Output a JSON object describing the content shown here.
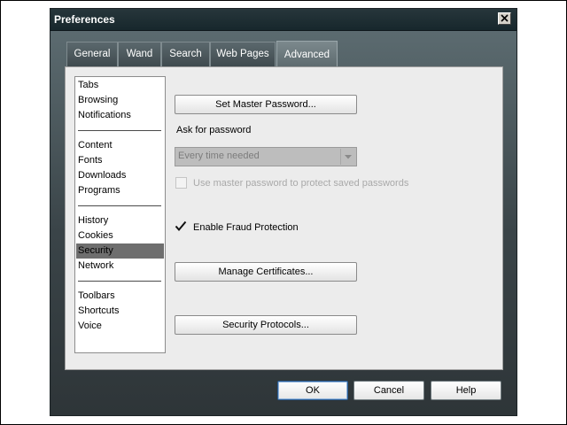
{
  "window": {
    "title": "Preferences"
  },
  "tabs": [
    {
      "label": "General",
      "active": false
    },
    {
      "label": "Wand",
      "active": false
    },
    {
      "label": "Search",
      "active": false
    },
    {
      "label": "Web Pages",
      "active": false
    },
    {
      "label": "Advanced",
      "active": true
    }
  ],
  "sidebar": {
    "groups": [
      [
        "Tabs",
        "Browsing",
        "Notifications"
      ],
      [
        "Content",
        "Fonts",
        "Downloads",
        "Programs"
      ],
      [
        "History",
        "Cookies",
        "Security",
        "Network"
      ],
      [
        "Toolbars",
        "Shortcuts",
        "Voice"
      ]
    ],
    "selected": "Security"
  },
  "security": {
    "master_password_button": "Set Master Password...",
    "ask_label": "Ask for password",
    "ask_select_value": "Every time needed",
    "use_master_label": "Use master password to protect saved passwords",
    "use_master_checked": false,
    "fraud_label": "Enable Fraud Protection",
    "fraud_checked": true,
    "manage_certs_button": "Manage Certificates...",
    "protocols_button": "Security Protocols..."
  },
  "buttons": {
    "ok": "OK",
    "cancel": "Cancel",
    "help": "Help"
  }
}
